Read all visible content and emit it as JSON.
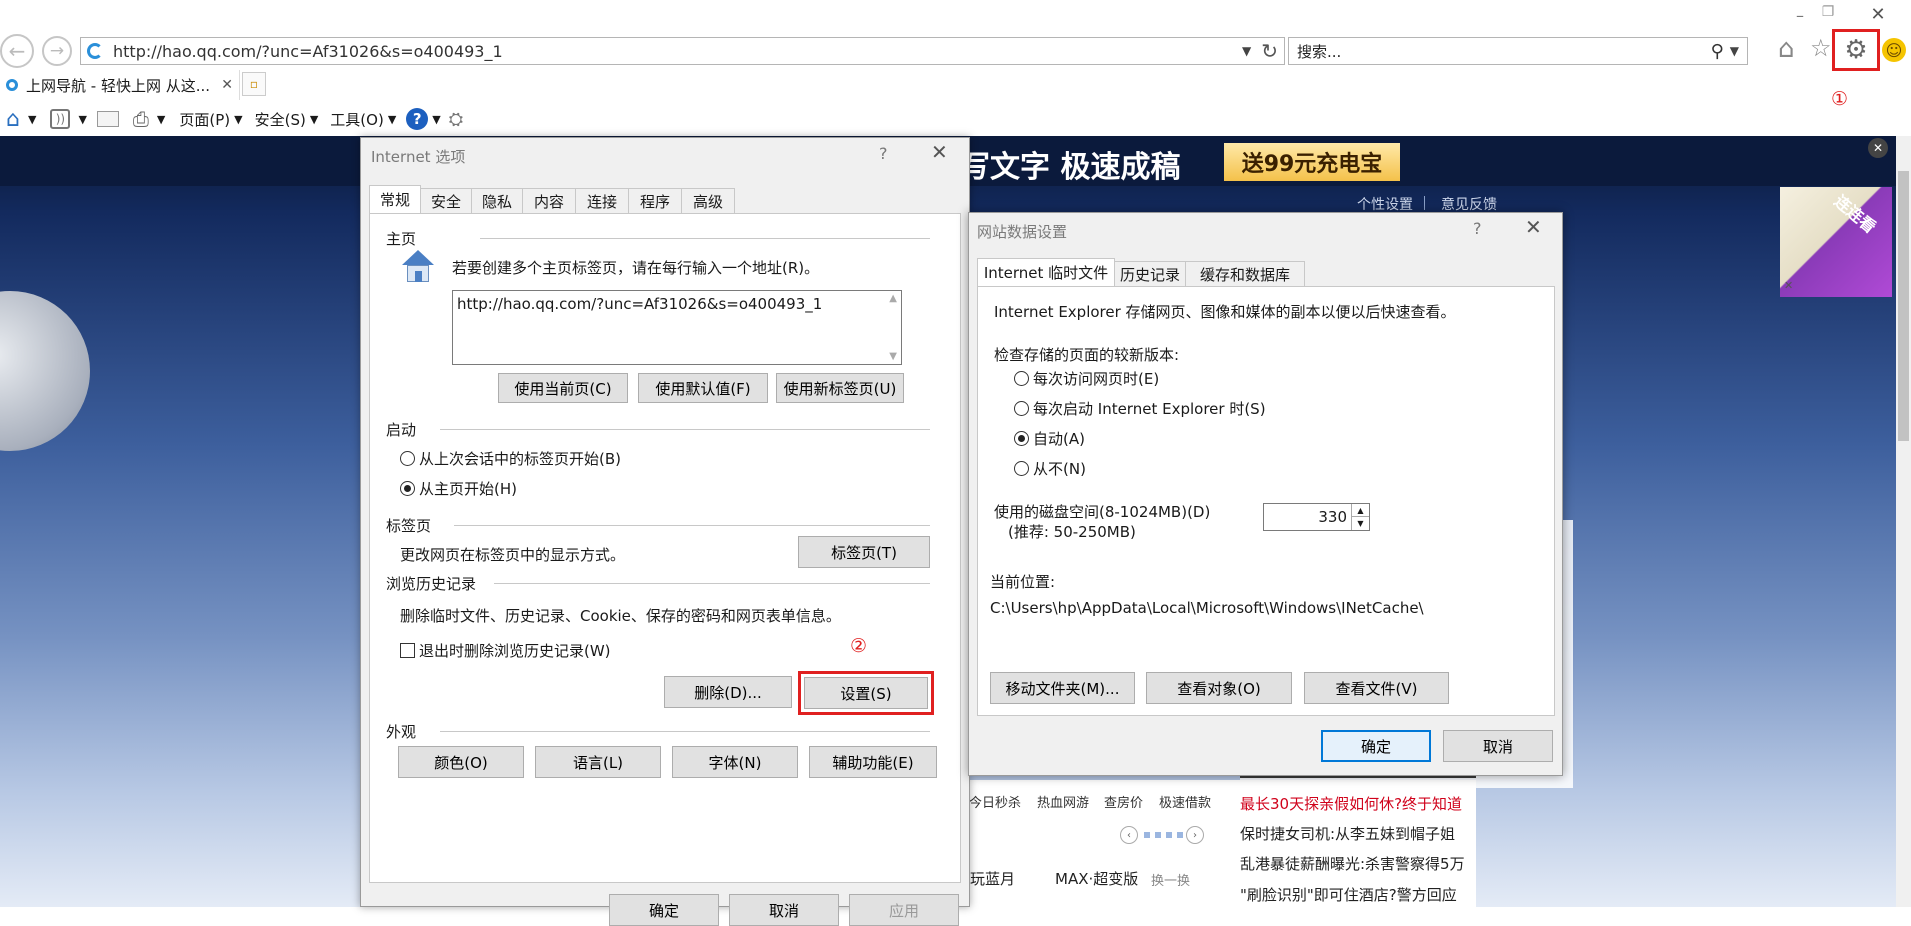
{
  "browser": {
    "url": "http://hao.qq.com/?unc=Af31026&s=o400493_1",
    "search_placeholder": "搜索...",
    "tab_title": "上网导航 - 轻快上网 从这...",
    "menu": {
      "page": "页面(P)",
      "safety": "安全(S)",
      "tools": "工具(O)"
    },
    "annotation_1": "①"
  },
  "page_bg": {
    "banner_text": "写文字 极速成稿",
    "promo": "送99元充电宝",
    "links": {
      "personal": "个性设置",
      "feedback": "意见反馈"
    },
    "ad_text": "连连看",
    "nav_tabs": [
      "今日秒杀",
      "热血网游",
      "查房价",
      "极速借款"
    ],
    "movies": [
      "玩蓝月",
      "MAX·超变版"
    ],
    "change_label": "换一换",
    "news": [
      "最长30天探亲假如何休?终于知道",
      "保时捷女司机:从李五妹到帽子姐",
      "乱港暴徒薪酬曝光:杀害警察得5万",
      "\"刷脸识别\"即可住酒店?警方回应"
    ]
  },
  "internet_options": {
    "title": "Internet 选项",
    "help": "?",
    "tabs": [
      "常规",
      "安全",
      "隐私",
      "内容",
      "连接",
      "程序",
      "高级"
    ],
    "homepage": {
      "header": "主页",
      "desc": "若要创建多个主页标签页，请在每行输入一个地址(R)。",
      "url": "http://hao.qq.com/?unc=Af31026&s=o400493_1",
      "btn_current": "使用当前页(C)",
      "btn_default": "使用默认值(F)",
      "btn_newtab": "使用新标签页(U)"
    },
    "startup": {
      "header": "启动",
      "opt_last": "从上次会话中的标签页开始(B)",
      "opt_home": "从主页开始(H)"
    },
    "tabs_section": {
      "header": "标签页",
      "desc": "更改网页在标签页中的显示方式。",
      "btn": "标签页(T)"
    },
    "history": {
      "header": "浏览历史记录",
      "desc": "删除临时文件、历史记录、Cookie、保存的密码和网页表单信息。",
      "checkbox": "退出时删除浏览历史记录(W)",
      "btn_delete": "删除(D)...",
      "btn_settings": "设置(S)",
      "annotation_2": "②"
    },
    "appearance": {
      "header": "外观",
      "btn_colors": "颜色(O)",
      "btn_languages": "语言(L)",
      "btn_fonts": "字体(N)",
      "btn_accessibility": "辅助功能(E)"
    },
    "bottom_buttons": [
      "确定",
      "取消",
      "应用"
    ]
  },
  "website_data": {
    "title": "网站数据设置",
    "help": "?",
    "tabs": [
      "Internet 临时文件",
      "历史记录",
      "缓存和数据库"
    ],
    "desc": "Internet Explorer 存储网页、图像和媒体的副本以便以后快速查看。",
    "check_label": "检查存储的页面的较新版本:",
    "options": [
      "每次访问网页时(E)",
      "每次启动 Internet Explorer 时(S)",
      "自动(A)",
      "从不(N)"
    ],
    "selected_option": "自动(A)",
    "disk_label": "使用的磁盘空间(8-1024MB)(D)",
    "disk_hint": "(推荐: 50-250MB)",
    "disk_value": "330",
    "location_label": "当前位置:",
    "location_path": "C:\\Users\\hp\\AppData\\Local\\Microsoft\\Windows\\INetCache\\",
    "btn_move": "移动文件夹(M)...",
    "btn_view_objects": "查看对象(O)",
    "btn_view_files": "查看文件(V)",
    "btn_ok": "确定",
    "btn_cancel": "取消"
  },
  "colors": {
    "accent": "#0078d7",
    "highlight_red": "#e02020",
    "news_red": "#d0021b"
  }
}
